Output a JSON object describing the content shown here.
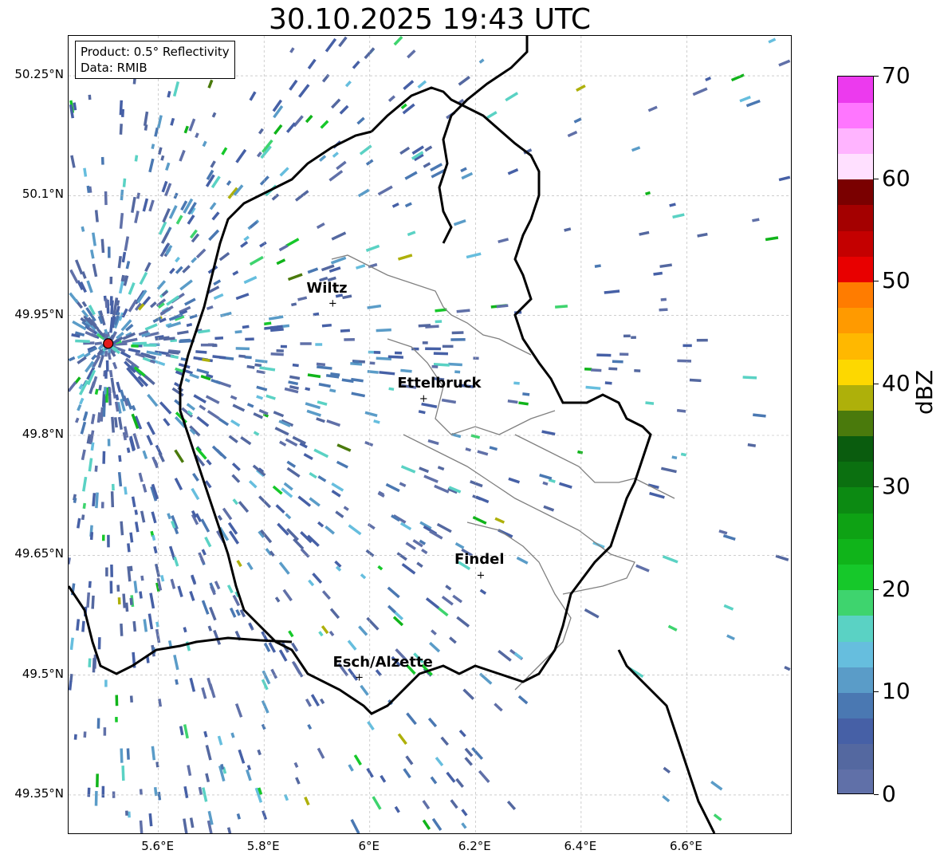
{
  "title": "30.10.2025 19:43 UTC",
  "info_box": {
    "product": "Product: 0.5° Reflectivity",
    "source": "Data: RMIB"
  },
  "map": {
    "lon_range": [
      5.43,
      6.8
    ],
    "lat_range": [
      49.3,
      50.3
    ],
    "lat_ticks": [
      {
        "value": 50.25,
        "label": "50.25°N"
      },
      {
        "value": 50.1,
        "label": "50.1°N"
      },
      {
        "value": 49.95,
        "label": "49.95°N"
      },
      {
        "value": 49.8,
        "label": "49.8°N"
      },
      {
        "value": 49.65,
        "label": "49.65°N"
      },
      {
        "value": 49.5,
        "label": "49.5°N"
      },
      {
        "value": 49.35,
        "label": "49.35°N"
      }
    ],
    "lon_ticks": [
      {
        "value": 5.6,
        "label": "5.6°E"
      },
      {
        "value": 5.8,
        "label": "5.8°E"
      },
      {
        "value": 6.0,
        "label": "6°E"
      },
      {
        "value": 6.2,
        "label": "6.2°E"
      },
      {
        "value": 6.4,
        "label": "6.4°E"
      },
      {
        "value": 6.6,
        "label": "6.6°E"
      }
    ],
    "radar_site": {
      "lon": 5.505,
      "lat": 49.915,
      "color": "#e41a1c"
    },
    "cities": [
      {
        "name": "Wiltz",
        "lon": 5.93,
        "lat": 49.966
      },
      {
        "name": "Ettelbruck",
        "lon": 6.102,
        "lat": 49.847
      },
      {
        "name": "Findel",
        "lon": 6.21,
        "lat": 49.626
      },
      {
        "name": "Esch/Alzette",
        "lon": 5.98,
        "lat": 49.498
      }
    ],
    "colors": {
      "border": "#000000",
      "canton_lines": "#808080",
      "grid": "#b0b0b0"
    }
  },
  "colorbar": {
    "label": "dBZ",
    "min": 0,
    "max": 70,
    "ticks": [
      0,
      10,
      20,
      30,
      40,
      50,
      60,
      70
    ],
    "colors": [
      "#6070a8",
      "#5468a0",
      "#4660a6",
      "#4a78b2",
      "#5a9cc8",
      "#66bede",
      "#5ad2c4",
      "#3ed46e",
      "#16c82a",
      "#10b41a",
      "#0ea214",
      "#0c8a12",
      "#0b7010",
      "#0a5c0e",
      "#4a7a0c",
      "#aeb00a",
      "#fdd800",
      "#ffb800",
      "#ff9a00",
      "#ff7c00",
      "#e80000",
      "#c40000",
      "#a40000",
      "#7a0000",
      "#ffe0ff",
      "#ffb4ff",
      "#ff76ff",
      "#ec3aee"
    ]
  }
}
